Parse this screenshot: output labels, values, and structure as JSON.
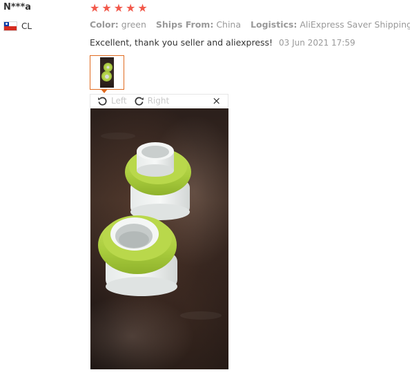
{
  "reviewer": {
    "name": "N***a",
    "country_code": "CL",
    "flag_icon": "chile-flag-icon"
  },
  "rating": {
    "stars": 5,
    "max": 5,
    "star_icon": "star-icon",
    "star_glyph": "★",
    "color": "#f2594b"
  },
  "attributes": [
    {
      "label": "Color:",
      "value": "green"
    },
    {
      "label": "Ships From:",
      "value": "China"
    },
    {
      "label": "Logistics:",
      "value": "AliExpress Saver Shipping"
    }
  ],
  "review": {
    "text": "Excellent, thank you seller and aliexpress!",
    "date": "03 Jun 2021 17:59"
  },
  "viewer": {
    "rotate_left_label": "Left",
    "rotate_right_label": "Right",
    "close_glyph": "×",
    "accent_color": "#e06a1f"
  }
}
